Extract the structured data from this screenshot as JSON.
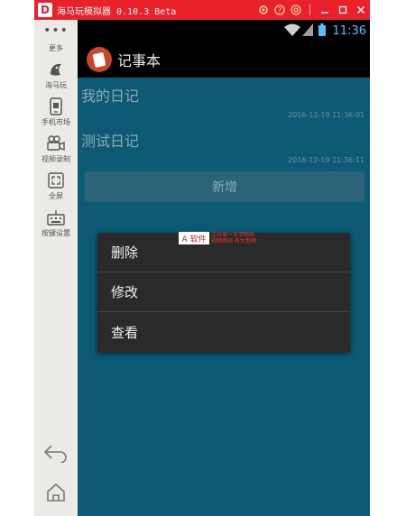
{
  "emulator": {
    "title": "海马玩模拟器 0.10.3 Beta",
    "logo_glyph": "D",
    "sidebar": {
      "more_label": "更多",
      "items": [
        {
          "label": "海马玩",
          "icon": "haima-logo-icon"
        },
        {
          "label": "手机市场",
          "icon": "phone-market-icon"
        },
        {
          "label": "视频录制",
          "icon": "video-camera-icon"
        },
        {
          "label": "全屏",
          "icon": "fullscreen-icon"
        },
        {
          "label": "按键设置",
          "icon": "keyboard-icon"
        }
      ]
    }
  },
  "status_bar": {
    "time": "11:36"
  },
  "app": {
    "title": "记事本",
    "notes": [
      {
        "title": "我的日记",
        "date": "2016-12-19 11:36:01"
      },
      {
        "title": "测试日记",
        "date": "2016-12-19 11:36:11"
      }
    ],
    "add_button": "新增"
  },
  "context_menu": {
    "items": [
      "删除",
      "修改",
      "查看"
    ]
  },
  "watermark": {
    "logo_text": "A 软件",
    "line1": "江苏省一支学网站",
    "line2": "视频网站 有大型网"
  },
  "colors": {
    "titlebar": "#e8212b",
    "screen_bg": "#0d5a74",
    "menu_bg": "#2a2a2a",
    "app_icon": "#c9462a"
  }
}
